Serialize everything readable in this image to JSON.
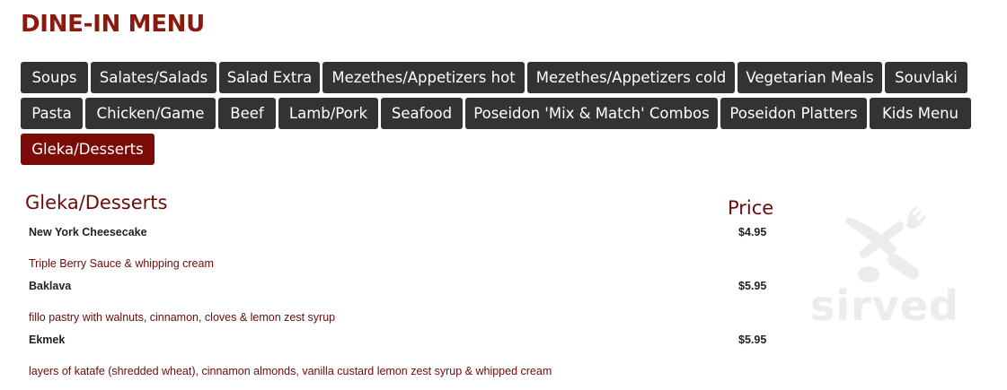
{
  "page": {
    "title": "DINE-IN MENU"
  },
  "tabs": [
    {
      "label": "Soups",
      "active": false
    },
    {
      "label": "Salates/Salads",
      "active": false
    },
    {
      "label": "Salad Extra",
      "active": false
    },
    {
      "label": "Mezethes/Appetizers hot",
      "active": false
    },
    {
      "label": "Mezethes/Appetizers cold",
      "active": false
    },
    {
      "label": "Vegetarian Meals",
      "active": false
    },
    {
      "label": "Souvlaki",
      "active": false
    },
    {
      "label": "Pasta",
      "active": false
    },
    {
      "label": "Chicken/Game",
      "active": false
    },
    {
      "label": "Beef",
      "active": false
    },
    {
      "label": "Lamb/Pork",
      "active": false
    },
    {
      "label": "Seafood",
      "active": false
    },
    {
      "label": "Poseidon 'Mix & Match' Combos",
      "active": false
    },
    {
      "label": "Poseidon Platters",
      "active": false
    },
    {
      "label": "Kids Menu",
      "active": false
    },
    {
      "label": "Gleka/Desserts",
      "active": true
    }
  ],
  "section": {
    "title": "Gleka/Desserts",
    "price_header": "Price",
    "items": [
      {
        "name": "New York Cheesecake",
        "price": "$4.95",
        "description": "Triple Berry Sauce & whipping cream"
      },
      {
        "name": "Baklava",
        "price": "$5.95",
        "description": "fillo pastry with walnuts, cinnamon, cloves & lemon zest syrup"
      },
      {
        "name": "Ekmek",
        "price": "$5.95",
        "description": "layers of katafe (shredded wheat), cinnamon almonds, vanilla custard lemon zest syrup & whipped cream"
      }
    ]
  },
  "watermark": {
    "text": "sirved",
    "icon": "fork-knife-icon",
    "color": "#ececec"
  },
  "colors": {
    "title": "#8b1a0e",
    "tab_bg": "#333333",
    "tab_active_bg": "#7a0b06",
    "tab_text": "#ffffff",
    "section_text": "#6b0b08",
    "item_name": "#222222"
  }
}
